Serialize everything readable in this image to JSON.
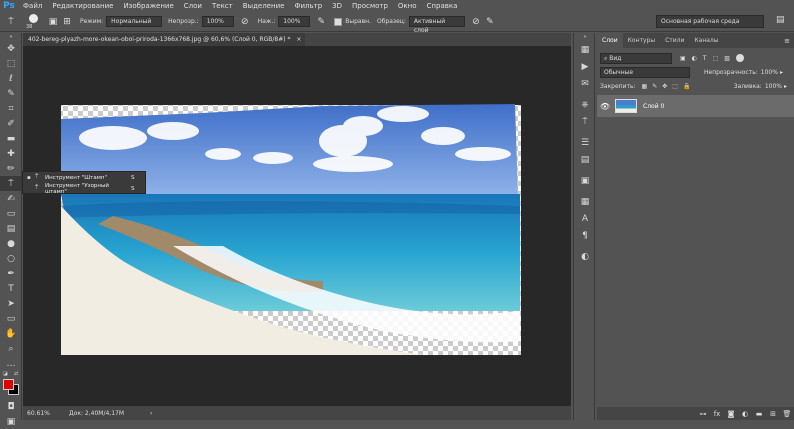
{
  "menu": {
    "logo": "Ps",
    "items": [
      "Файл",
      "Редактирование",
      "Изображение",
      "Слои",
      "Текст",
      "Выделение",
      "Фильтр",
      "3D",
      "Просмотр",
      "Окно",
      "Справка"
    ]
  },
  "options": {
    "brush_size": "38",
    "mode_label": "Режим:",
    "mode_value": "Нормальный",
    "opacity_label": "Непрозр.:",
    "opacity_value": "100%",
    "flow_label": "Наж.:",
    "flow_value": "100%",
    "aligned_label": "Выравн.",
    "sample_label": "Образец:",
    "sample_value": "Активный слой"
  },
  "workspace": "Основная рабочая среда",
  "document": {
    "tab_title": "402-bereg-plyazh-more-okean-oboi-priroda-1366x768.jpg @ 60,6% (Слой 0, RGB/8#) *",
    "close": "×"
  },
  "status": {
    "zoom": "60.61%",
    "doc": "Док: 2,40M/4,17M"
  },
  "flyout": {
    "items": [
      {
        "label": "Инструмент \"Штамп\"",
        "key": "S"
      },
      {
        "label": "Инструмент \"Узорный штамп\"",
        "key": "S"
      }
    ]
  },
  "panel": {
    "tabs": [
      "Слои",
      "Контуры",
      "Стили",
      "Каналы"
    ],
    "filter_label": "Вид",
    "blend_mode": "Обычные",
    "opacity_label": "Непрозрачность:",
    "opacity_value": "100%",
    "lock_label": "Закрепить:",
    "fill_label": "Заливка:",
    "fill_value": "100%",
    "layer_name": "Слой 0"
  }
}
